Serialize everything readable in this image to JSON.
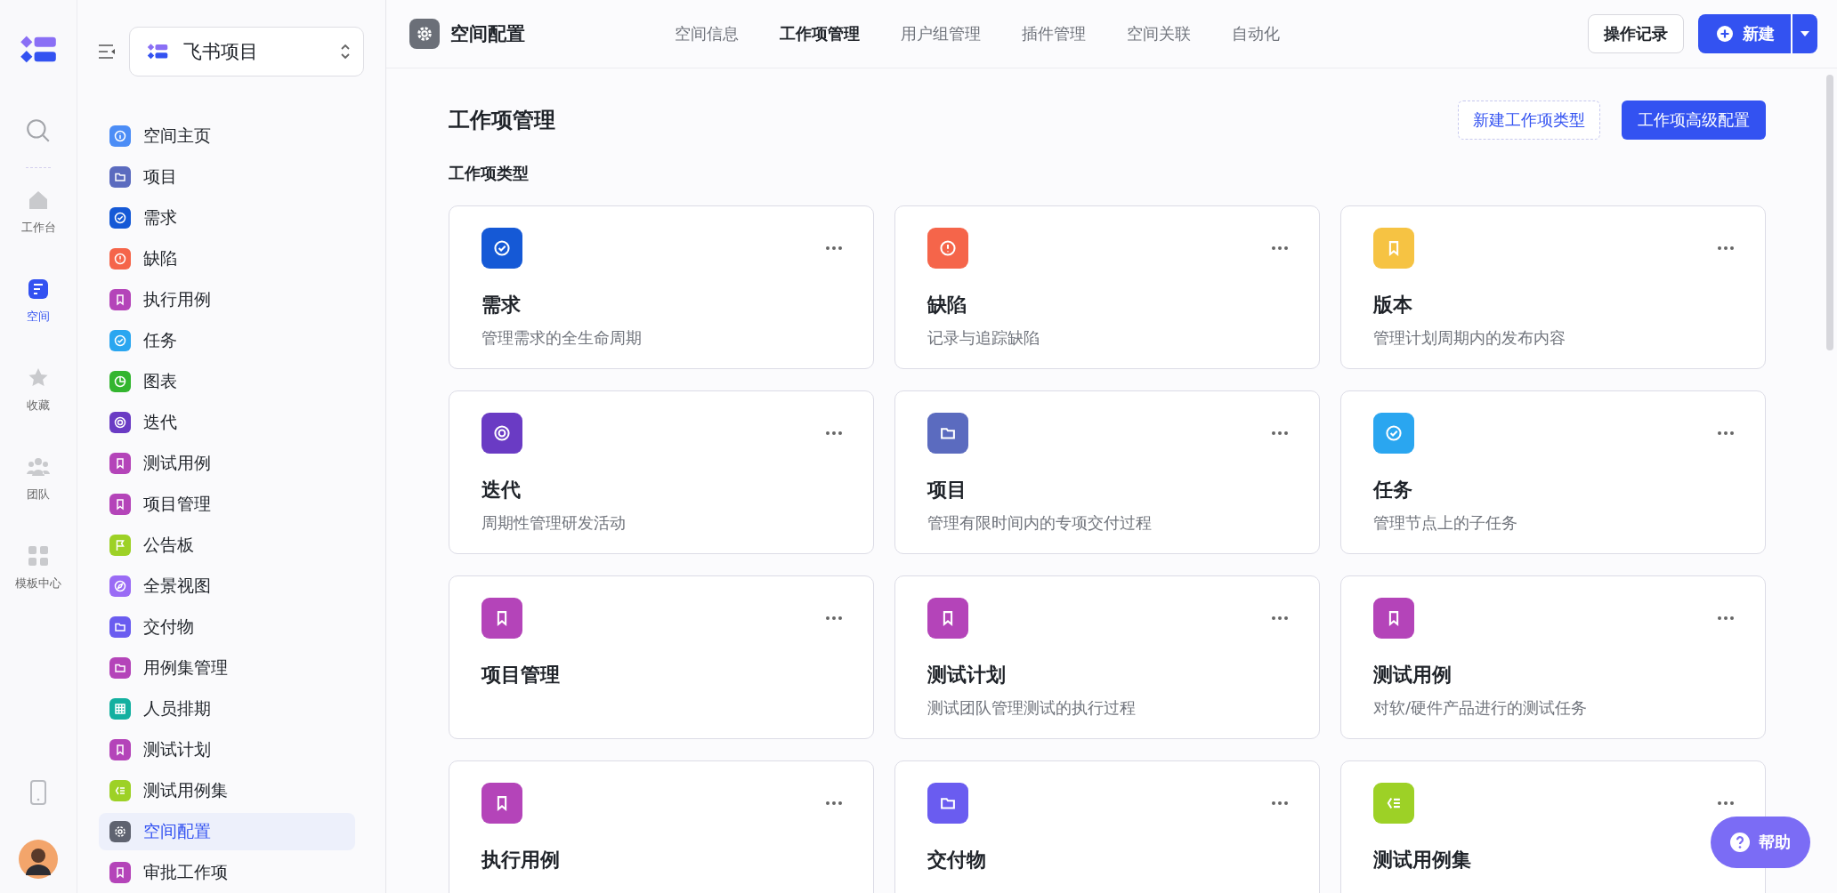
{
  "rail": {
    "items": [
      {
        "label": "工作台",
        "kind": "home",
        "selected": false
      },
      {
        "label": "空间",
        "kind": "space",
        "selected": true
      },
      {
        "label": "收藏",
        "kind": "star",
        "selected": false
      },
      {
        "label": "团队",
        "kind": "team",
        "selected": false
      },
      {
        "label": "模板中心",
        "kind": "templates",
        "selected": false
      }
    ]
  },
  "sidebar": {
    "space_name": "飞书项目",
    "items": [
      {
        "label": "空间主页",
        "kind": "info",
        "color": "#4c8df6",
        "selected": false
      },
      {
        "label": "项目",
        "kind": "folder",
        "color": "#5b6bbf",
        "selected": false
      },
      {
        "label": "需求",
        "kind": "check",
        "color": "#1559d6",
        "selected": false
      },
      {
        "label": "缺陷",
        "kind": "alert",
        "color": "#f5654a",
        "selected": false
      },
      {
        "label": "执行用例",
        "kind": "bookmark",
        "color": "#b444b9",
        "selected": false
      },
      {
        "label": "任务",
        "kind": "check",
        "color": "#2aa6f0",
        "selected": false
      },
      {
        "label": "图表",
        "kind": "pie",
        "color": "#33b52f",
        "selected": false
      },
      {
        "label": "迭代",
        "kind": "swirl",
        "color": "#6a3bc4",
        "selected": false
      },
      {
        "label": "测试用例",
        "kind": "bookmark",
        "color": "#b444b9",
        "selected": false
      },
      {
        "label": "项目管理",
        "kind": "bookmark",
        "color": "#b444b9",
        "selected": false
      },
      {
        "label": "公告板",
        "kind": "flag",
        "color": "#9dd126",
        "selected": false
      },
      {
        "label": "全景视图",
        "kind": "compass",
        "color": "#9a6bf5",
        "selected": false
      },
      {
        "label": "交付物",
        "kind": "folder",
        "color": "#6a5cf0",
        "selected": false
      },
      {
        "label": "用例集管理",
        "kind": "folder",
        "color": "#b444b9",
        "selected": false
      },
      {
        "label": "人员排期",
        "kind": "grid",
        "color": "#13b0a0",
        "selected": false
      },
      {
        "label": "测试计划",
        "kind": "bookmark",
        "color": "#b444b9",
        "selected": false
      },
      {
        "label": "测试用例集",
        "kind": "list",
        "color": "#9dd126",
        "selected": false
      },
      {
        "label": "空间配置",
        "kind": "gear",
        "color": "#5f6370",
        "selected": true
      },
      {
        "label": "审批工作项",
        "kind": "bookmark",
        "color": "#b444b9",
        "selected": false
      }
    ]
  },
  "header": {
    "title": "空间配置",
    "tabs": [
      {
        "label": "空间信息",
        "selected": false
      },
      {
        "label": "工作项管理",
        "selected": true
      },
      {
        "label": "用户组管理",
        "selected": false
      },
      {
        "label": "插件管理",
        "selected": false
      },
      {
        "label": "空间关联",
        "selected": false
      },
      {
        "label": "自动化",
        "selected": false
      }
    ],
    "log_button": "操作记录",
    "new_button": "新建"
  },
  "page": {
    "title": "工作项管理",
    "new_type_button": "新建工作项类型",
    "advanced_button": "工作项高级配置",
    "section": "工作项类型",
    "cards": [
      {
        "name": "需求",
        "description": "管理需求的全生命周期",
        "kind": "check",
        "color": "#1559d6"
      },
      {
        "name": "缺陷",
        "description": "记录与追踪缺陷",
        "kind": "alert",
        "color": "#f5654a"
      },
      {
        "name": "版本",
        "description": "管理计划周期内的发布内容",
        "kind": "bookmark",
        "color": "#f6c343"
      },
      {
        "name": "迭代",
        "description": "周期性管理研发活动",
        "kind": "swirl",
        "color": "#6a3bc4"
      },
      {
        "name": "项目",
        "description": "管理有限时间内的专项交付过程",
        "kind": "folder",
        "color": "#5b6bbf"
      },
      {
        "name": "任务",
        "description": "管理节点上的子任务",
        "kind": "check",
        "color": "#2aa6f0"
      },
      {
        "name": "项目管理",
        "kind": "bookmark",
        "color": "#b444b9"
      },
      {
        "name": "测试计划",
        "description": "测试团队管理测试的执行过程",
        "kind": "bookmark",
        "color": "#b444b9"
      },
      {
        "name": "测试用例",
        "description": "对软/硬件产品进行的测试任务",
        "kind": "bookmark",
        "color": "#b444b9"
      },
      {
        "name": "执行用例",
        "kind": "bookmark",
        "color": "#b444b9"
      },
      {
        "name": "交付物",
        "kind": "folder",
        "color": "#6a5cf0"
      },
      {
        "name": "测试用例集",
        "kind": "list",
        "color": "#9dd126"
      }
    ]
  },
  "help_button": "帮助"
}
